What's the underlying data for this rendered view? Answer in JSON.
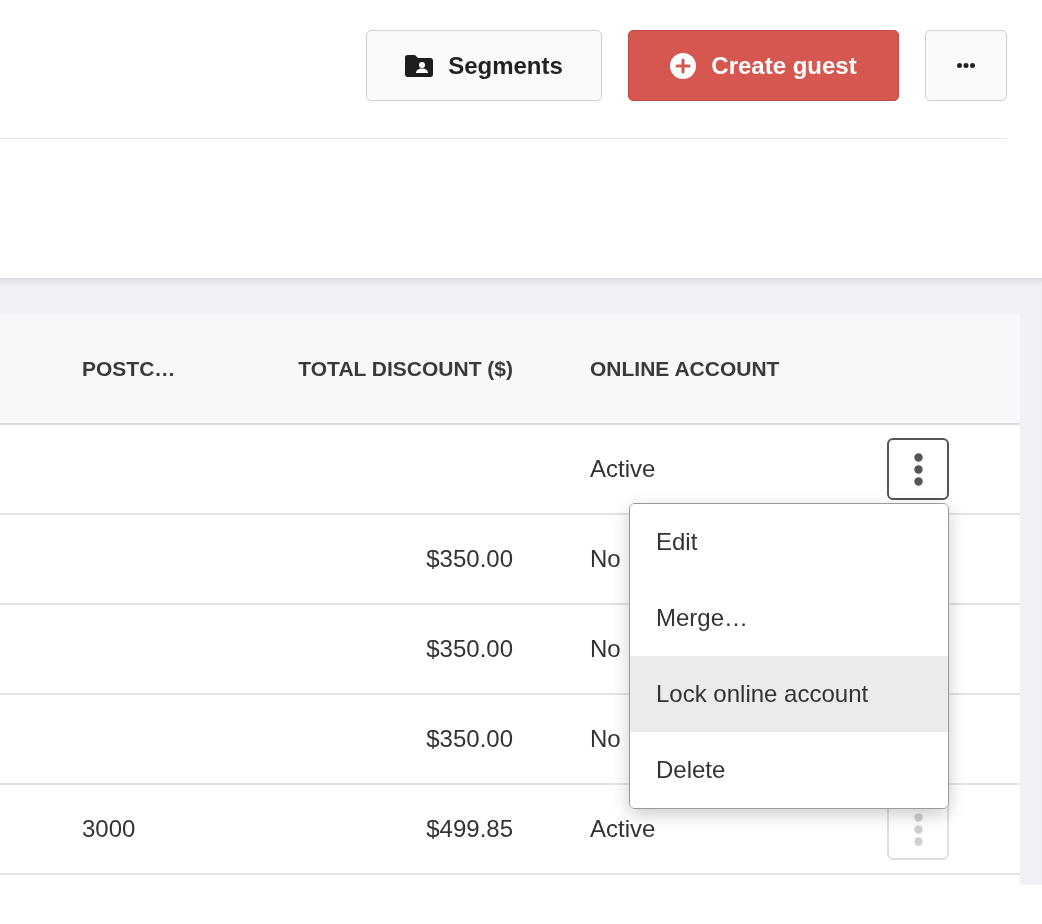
{
  "toolbar": {
    "buttons": [
      {
        "kind": "segments",
        "label": "Segments"
      },
      {
        "kind": "primary",
        "label": "Create guest"
      },
      {
        "kind": "more"
      }
    ]
  },
  "table": {
    "columns": [
      "POSTC…",
      "TOTAL DISCOUNT ($)",
      "ONLINE ACCOUNT"
    ],
    "rows": [
      {
        "online_account": "Active",
        "actions": {
          "open": true
        }
      },
      {
        "total_discount": "$350.00",
        "online_account": "No"
      },
      {
        "total_discount": "$350.00",
        "online_account": "No"
      },
      {
        "total_discount": "$350.00",
        "online_account": "No"
      },
      {
        "postcode": "3000",
        "total_discount": "$499.85",
        "online_account": "Active",
        "actions": {
          "open": false
        }
      }
    ]
  },
  "menu": {
    "items": [
      {
        "label": "Edit",
        "highlighted": false
      },
      {
        "label": "Merge…",
        "highlighted": false
      },
      {
        "label": "Lock online account",
        "highlighted": true
      },
      {
        "label": "Delete",
        "highlighted": false
      }
    ]
  }
}
